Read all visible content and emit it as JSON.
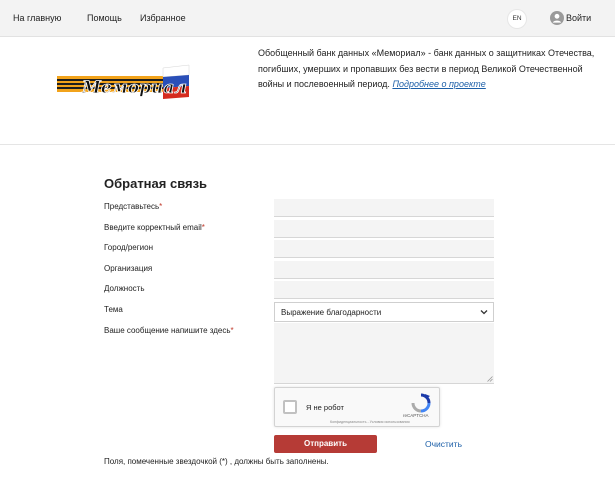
{
  "nav": {
    "home": "На главную",
    "help": "Помощь",
    "favorites": "Избранное",
    "lang": "EN",
    "login": "Войти"
  },
  "header": {
    "logo_text": "Мемориал",
    "intro": "Обобщенный банк данных «Мемориал» - банк данных о защитниках Отечества, погибших, умерших и пропавших без вести в период Великой Отечественной войны и послевоенный период.",
    "more_link": "Подробнее о проекте"
  },
  "form": {
    "title": "Обратная связь",
    "fields": {
      "name_label": "Представьтесь",
      "email_label": "Введите корректный email",
      "city_label": "Город/регион",
      "org_label": "Организация",
      "position_label": "Должность",
      "topic_label": "Тема",
      "message_label": "Ваше сообщение напишите здесь"
    },
    "required_mark": "*",
    "topic_selected": "Выражение благодарности",
    "captcha": {
      "label": "Я не робот",
      "brand": "reCAPTCHA",
      "terms": "Конфиденциальность - Условия использования"
    },
    "submit_label": "Отправить",
    "clear_label": "Очистить",
    "footnote": "Поля, помеченные звездочкой (*) , должны быть заполнены."
  },
  "colors": {
    "submit_bg": "#b63b36",
    "link": "#1c5fa8",
    "required": "#c0392b",
    "topbar_bg": "#f3f3f3"
  },
  "icons": {
    "avatar": "user-avatar-icon",
    "dropdown": "chevron-down-icon",
    "captcha": "recaptcha-logo-icon"
  }
}
